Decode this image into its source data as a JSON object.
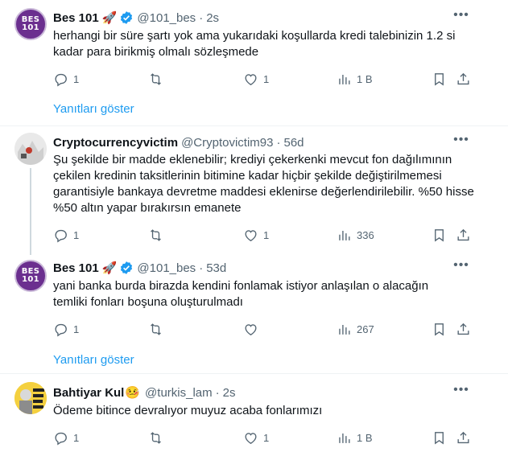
{
  "tweets": [
    {
      "name": "Bes 101",
      "emoji": "🚀",
      "handle": "@101_bes",
      "time": "2s",
      "text": "herhangi bir süre şartı yok ama yukarıdaki koşullarda kredi talebinizin 1.2 si kadar para birikmiş olmalı sözleşmede",
      "replies": "1",
      "likes": "1",
      "views": "1 B",
      "show_replies": "Yanıtları göster",
      "avatar_text": [
        "BES",
        "101"
      ]
    },
    {
      "name": "Cryptocurrencyvictim",
      "handle": "@Cryptovictim93",
      "time": "56d",
      "text": "Şu şekilde bir madde eklenebilir; krediyi çekerkenki mevcut fon dağılımının çekilen kredinin taksitlerinin bitimine kadar hiçbir şekilde değiştirilmemesi garantisiyle bankaya devretme maddesi eklenirse değerlendirilebilir. %50 hisse %50 altın yapar bırakırsın emanete",
      "replies": "1",
      "likes": "1",
      "views": "336"
    },
    {
      "name": "Bes 101",
      "emoji": "🚀",
      "handle": "@101_bes",
      "time": "53d",
      "text": "yani banka burda birazda kendini fonlamak istiyor anlaşılan o alacağın temliki fonları boşuna oluşturulmadı",
      "replies": "1",
      "likes": "",
      "views": "267",
      "show_replies": "Yanıtları göster",
      "avatar_text": [
        "BES",
        "101"
      ]
    },
    {
      "name": "Bahtiyar Kul",
      "emoji": "🤒",
      "handle": "@turkis_lam",
      "time": "2s",
      "text": "Ödeme bitince devralıyor muyuz acaba fonlarımızı",
      "replies": "1",
      "likes": "1",
      "views": "1 B"
    }
  ],
  "separator": "·",
  "more_icon": "more-horizontal-icon",
  "colors": {
    "link": "#1d9bf0",
    "muted": "#536471",
    "verified": "#1d9bf0",
    "avatar_bes": "#6b2f8f"
  }
}
